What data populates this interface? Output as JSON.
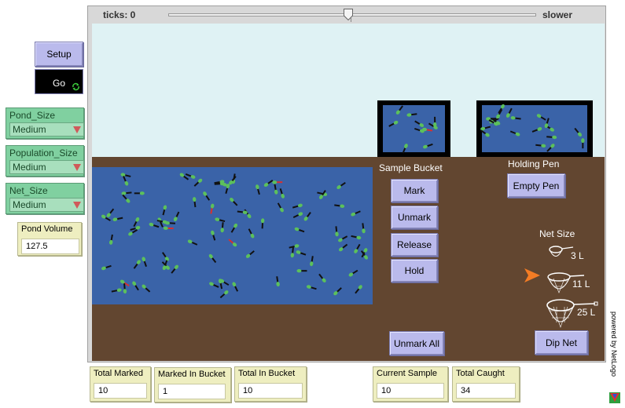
{
  "controls": {
    "setup_label": "Setup",
    "go_label": "Go"
  },
  "choosers": {
    "pond_size": {
      "label": "Pond_Size",
      "value": "Medium"
    },
    "population_size": {
      "label": "Population_Size",
      "value": "Medium"
    },
    "net_size": {
      "label": "Net_Size",
      "value": "Medium"
    }
  },
  "pond_volume": {
    "label": "Pond Volume",
    "value": "127.5"
  },
  "view": {
    "ticks_label": "ticks: 0",
    "speed_label": "slower",
    "speed_fraction": 0.49,
    "sample_bucket_label": "Sample Bucket",
    "holding_pen_label": "Holding Pen",
    "net_size_label": "Net Size",
    "net_sizes": [
      "3 L",
      "11 L",
      "25 L"
    ],
    "selected_net": "11 L",
    "buttons": {
      "mark": "Mark",
      "unmark": "Unmark",
      "release": "Release",
      "hold": "Hold",
      "unmark_all": "Unmark All",
      "empty_pen": "Empty Pen",
      "dip_net": "Dip Net"
    },
    "colors": {
      "sky": "#dff2f4",
      "water": "#3a63a8",
      "ground": "#624630",
      "fish": "#5cc05c"
    }
  },
  "monitors": {
    "total_marked": {
      "label": "Total Marked",
      "value": "10"
    },
    "marked_in_bucket": {
      "label": "Marked In Bucket",
      "value": "1"
    },
    "total_in_bucket": {
      "label": "Total In Bucket",
      "value": "10"
    },
    "current_sample": {
      "label": "Current Sample",
      "value": "10"
    },
    "total_caught": {
      "label": "Total Caught",
      "value": "34"
    }
  },
  "branding": {
    "powered_by": "powered by NetLogo"
  }
}
